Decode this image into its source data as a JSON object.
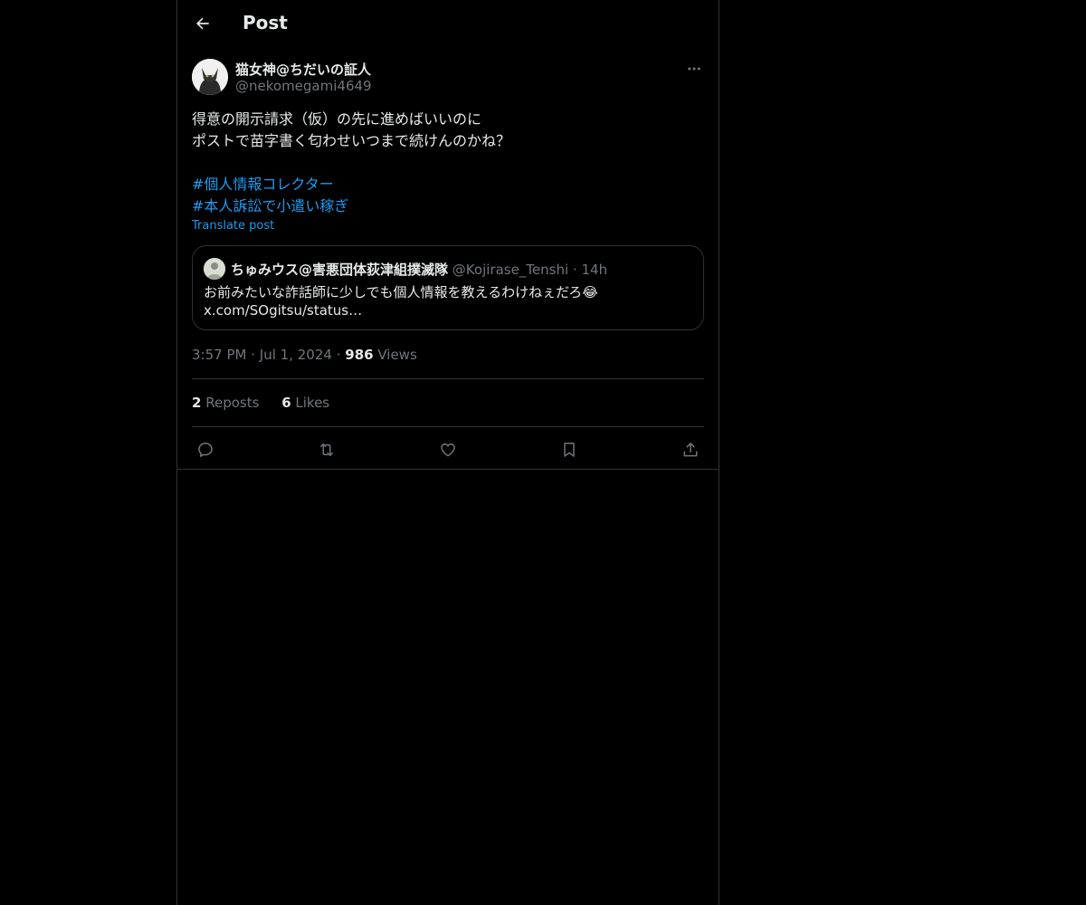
{
  "header": {
    "title": "Post"
  },
  "post": {
    "author_name": "猫女神@ちだいの証人",
    "author_handle": "@nekomegami4649",
    "text_lines": [
      "得意の開示請求（仮）の先に進めばいいのに",
      "ポストで苗字書く匂わせいつまで続けんのかね？"
    ],
    "hashtags": [
      "#個人情報コレクター",
      "#本人訴訟で小遣い稼ぎ"
    ],
    "translate_label": "Translate post",
    "quote": {
      "name": "ちゅみウス@害悪団体荻津組撲滅隊",
      "handle": "@Kojirase_Tenshi",
      "dot": "·",
      "time": "14h",
      "text_line1": "お前みたいな詐話師に少しでも個人情報を教えるわけねぇだろ😂",
      "text_line2": "x.com/SOgitsu/status…"
    },
    "time": "3:57 PM",
    "sep1": "·",
    "date": "Jul 1, 2024",
    "sep2": "·",
    "views_count": "986",
    "views_label": "Views",
    "reposts_count": "2",
    "reposts_label": "Reposts",
    "likes_count": "6",
    "likes_label": "Likes"
  },
  "colors": {
    "background": "#000000",
    "text": "#e7e9ea",
    "muted": "#71767b",
    "accent": "#1d9bf0",
    "border": "#2f3336"
  },
  "icons": [
    "back-arrow-icon",
    "more-icon",
    "reply-icon",
    "repost-icon",
    "like-icon",
    "bookmark-icon",
    "share-icon"
  ]
}
